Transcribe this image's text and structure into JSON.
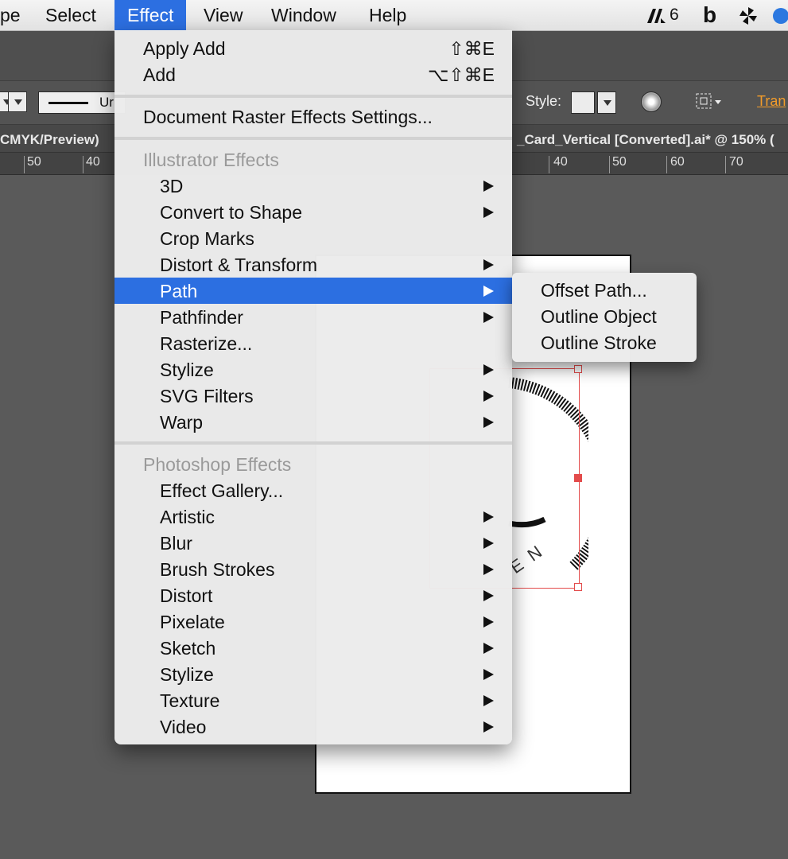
{
  "menubar": {
    "items": [
      "pe",
      "Select",
      "Effect",
      "View",
      "Window",
      "Help"
    ],
    "active": "Effect",
    "tray": {
      "adobe_count": "6",
      "letter_icon": "b"
    }
  },
  "control_bar": {
    "stroke_text": "Ur",
    "style_label": "Style:",
    "transform_link": "Tran"
  },
  "document": {
    "left_tab": "CMYK/Preview)",
    "right_tab": "_Card_Vertical [Converted].ai* @ 150% (",
    "ruler_left": [
      "50",
      "40"
    ],
    "ruler_right": [
      "40",
      "50",
      "60",
      "70"
    ]
  },
  "artwork": {
    "text": "E N"
  },
  "effect_menu": {
    "apply_add": {
      "label": "Apply Add",
      "shortcut": "⇧⌘E"
    },
    "add": {
      "label": "Add",
      "shortcut": "⌥⇧⌘E"
    },
    "document_raster": "Document Raster Effects Settings...",
    "illustrator_header": "Illustrator Effects",
    "illustrator_items": [
      {
        "label": "3D",
        "submenu": true
      },
      {
        "label": "Convert to Shape",
        "submenu": true
      },
      {
        "label": "Crop Marks",
        "submenu": false
      },
      {
        "label": "Distort & Transform",
        "submenu": true
      },
      {
        "label": "Path",
        "submenu": true,
        "highlighted": true
      },
      {
        "label": "Pathfinder",
        "submenu": true
      },
      {
        "label": "Rasterize...",
        "submenu": false
      },
      {
        "label": "Stylize",
        "submenu": true
      },
      {
        "label": "SVG Filters",
        "submenu": true
      },
      {
        "label": "Warp",
        "submenu": true
      }
    ],
    "photoshop_header": "Photoshop Effects",
    "photoshop_items": [
      {
        "label": "Effect Gallery...",
        "submenu": false
      },
      {
        "label": "Artistic",
        "submenu": true
      },
      {
        "label": "Blur",
        "submenu": true
      },
      {
        "label": "Brush Strokes",
        "submenu": true
      },
      {
        "label": "Distort",
        "submenu": true
      },
      {
        "label": "Pixelate",
        "submenu": true
      },
      {
        "label": "Sketch",
        "submenu": true
      },
      {
        "label": "Stylize",
        "submenu": true
      },
      {
        "label": "Texture",
        "submenu": true
      },
      {
        "label": "Video",
        "submenu": true
      }
    ]
  },
  "path_submenu": {
    "items": [
      "Offset Path...",
      "Outline Object",
      "Outline Stroke"
    ]
  },
  "colors": {
    "highlight": "#2c6fe1",
    "header_text": "#9a9a9a",
    "selection": "#e34b4b"
  }
}
